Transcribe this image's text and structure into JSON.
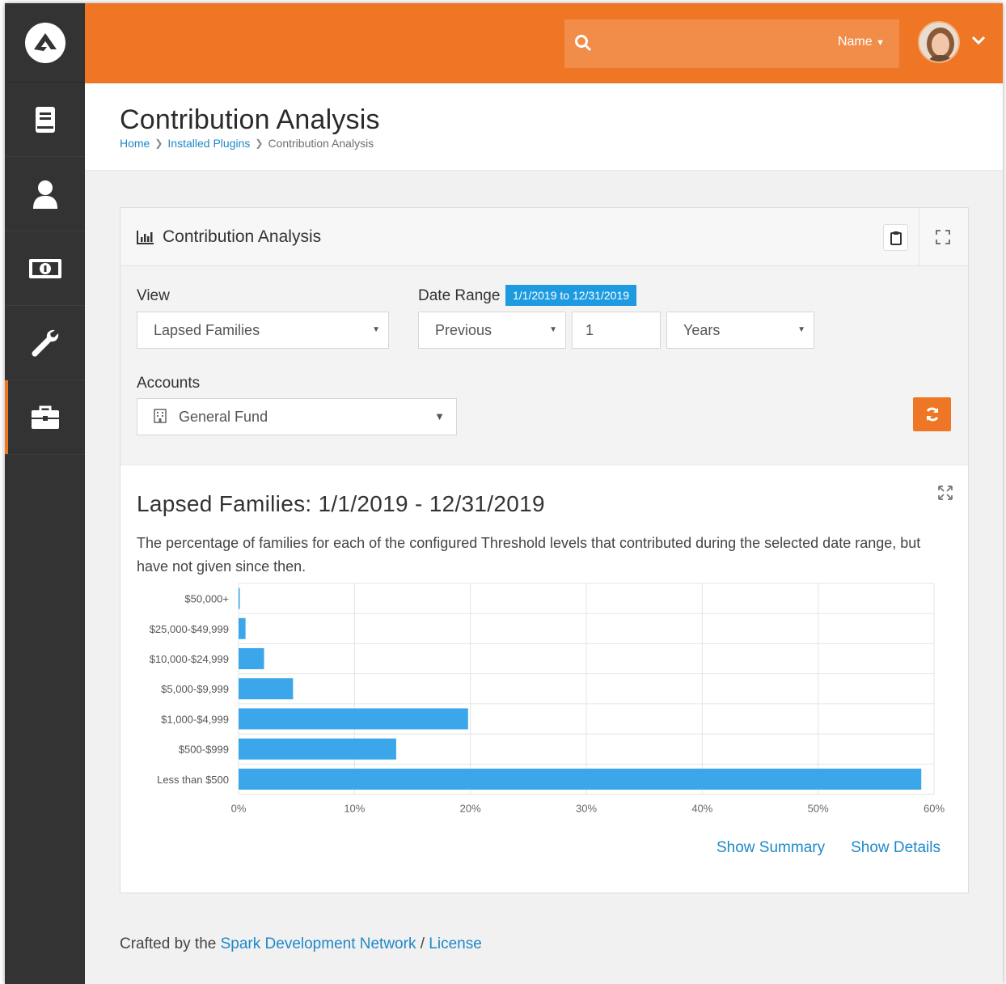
{
  "header": {
    "search_person_label": "Name",
    "search_placeholder": ""
  },
  "sidebar": {
    "items": [
      {
        "icon": "book-icon"
      },
      {
        "icon": "person-icon"
      },
      {
        "icon": "money-icon"
      },
      {
        "icon": "wrench-icon"
      },
      {
        "icon": "briefcase-icon",
        "active": true
      }
    ]
  },
  "page": {
    "title": "Contribution Analysis",
    "breadcrumb": [
      "Home",
      "Installed Plugins",
      "Contribution Analysis"
    ]
  },
  "panel": {
    "title": "Contribution Analysis",
    "view_label": "View",
    "view_value": "Lapsed Families",
    "date_range_label": "Date Range",
    "date_range_badge": "1/1/2019 to 12/31/2019",
    "date_mode": "Previous",
    "date_count": "1",
    "date_unit": "Years",
    "accounts_label": "Accounts",
    "accounts_value": "General Fund"
  },
  "chart_section": {
    "title": "Lapsed Families: 1/1/2019 - 12/31/2019",
    "description": "The percentage of families for each of the configured Threshold levels that contributed during the selected date range, but have not given since then.",
    "show_summary": "Show Summary",
    "show_details": "Show Details"
  },
  "chart_data": {
    "type": "bar",
    "orientation": "horizontal",
    "categories": [
      "$50,000+",
      "$25,000-$49,999",
      "$10,000-$24,999",
      "$5,000-$9,999",
      "$1,000-$4,999",
      "$500-$999",
      "Less than $500"
    ],
    "values": [
      0.1,
      0.6,
      2.2,
      4.7,
      19.8,
      13.6,
      58.9
    ],
    "xlim": [
      0,
      60
    ],
    "xticks": [
      "0%",
      "10%",
      "20%",
      "30%",
      "40%",
      "50%",
      "60%"
    ],
    "bar_color": "#3ba6ea",
    "grid": true
  },
  "footer": {
    "prefix": "Crafted by the",
    "org_link": "Spark Development Network",
    "sep": "/",
    "license_link": "License"
  },
  "colors": {
    "brand_orange": "#ee7624",
    "sidebar": "#333333",
    "link_blue": "#1e88c9"
  }
}
